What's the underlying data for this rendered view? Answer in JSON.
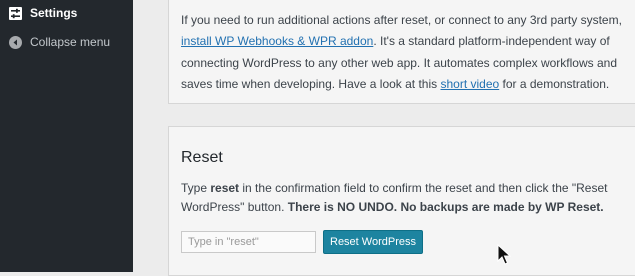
{
  "sidebar": {
    "items": [
      {
        "label": "Settings",
        "icon": "settings-icon",
        "active": true
      },
      {
        "label": "Collapse menu",
        "icon": "collapse-arrow-icon",
        "active": false
      }
    ],
    "background": "#23282d"
  },
  "webhooks_card": {
    "text_before_link1": "If you need to run additional actions after reset, or connect to any 3rd party system, ",
    "link1": "install WP Webhooks & WPR addon",
    "text_after_link1": ". It's a standard platform-independent way of connecting WordPress to any other web app. It automates complex workflows and saves time when developing. Have a look at this ",
    "link2": "short video",
    "text_after_link2": " for a demonstration."
  },
  "reset_card": {
    "title": "Reset",
    "desc_part1": "Type ",
    "desc_keyword": "reset",
    "desc_part2": " in the confirmation field to confirm the reset and then click the \"Reset WordPress\" button. ",
    "desc_warning": "There is NO UNDO. No backups are made by WP Reset.",
    "input_placeholder": "Type in \"reset\"",
    "input_value": "",
    "button_label": "Reset WordPress"
  },
  "colors": {
    "link": "#2271b1",
    "button": "#1d84a0",
    "content_background": "#ececec"
  }
}
